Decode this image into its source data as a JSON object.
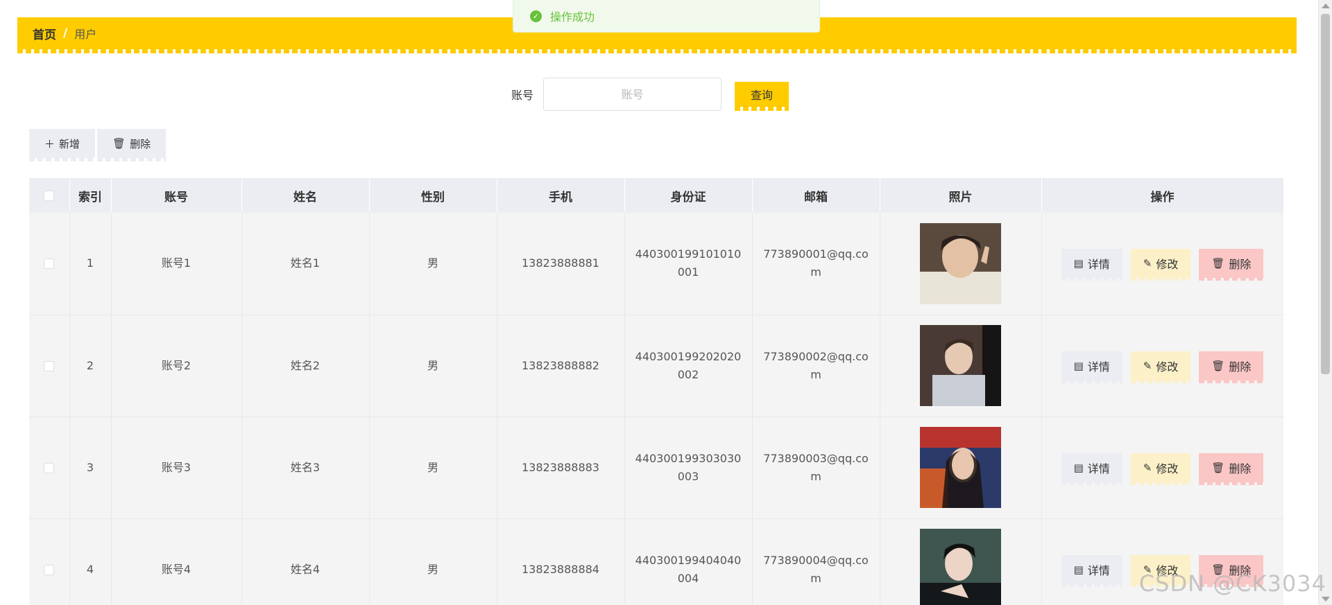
{
  "toast": {
    "message": "操作成功"
  },
  "breadcrumb": {
    "home": "首页",
    "separator": "/",
    "current": "用户"
  },
  "search": {
    "label": "账号",
    "placeholder": "账号",
    "value": "",
    "query_label": "查询"
  },
  "actions": {
    "add_label": "新增",
    "delete_label": "删除"
  },
  "table": {
    "headers": [
      "索引",
      "账号",
      "姓名",
      "性别",
      "手机",
      "身份证",
      "邮箱",
      "照片",
      "操作"
    ],
    "op_labels": {
      "detail": "详情",
      "edit": "修改",
      "delete": "删除"
    },
    "rows": [
      {
        "index": "1",
        "account": "账号1",
        "name": "姓名1",
        "gender": "男",
        "phone": "13823888881",
        "id_card": "440300199101010001",
        "email": "773890001@qq.com"
      },
      {
        "index": "2",
        "account": "账号2",
        "name": "姓名2",
        "gender": "男",
        "phone": "13823888882",
        "id_card": "440300199202020002",
        "email": "773890002@qq.com"
      },
      {
        "index": "3",
        "account": "账号3",
        "name": "姓名3",
        "gender": "男",
        "phone": "13823888883",
        "id_card": "440300199303030003",
        "email": "773890003@qq.com"
      },
      {
        "index": "4",
        "account": "账号4",
        "name": "姓名4",
        "gender": "男",
        "phone": "13823888884",
        "id_card": "440300199404040004",
        "email": "773890004@qq.com"
      }
    ]
  },
  "watermark": "CSDN @CK3034",
  "colors": {
    "accent": "#ffcc00",
    "success": "#67c23a",
    "danger_bg": "#fbc6c6",
    "edit_bg": "#fbf0c8",
    "neutral_bg": "#ebedf2"
  }
}
